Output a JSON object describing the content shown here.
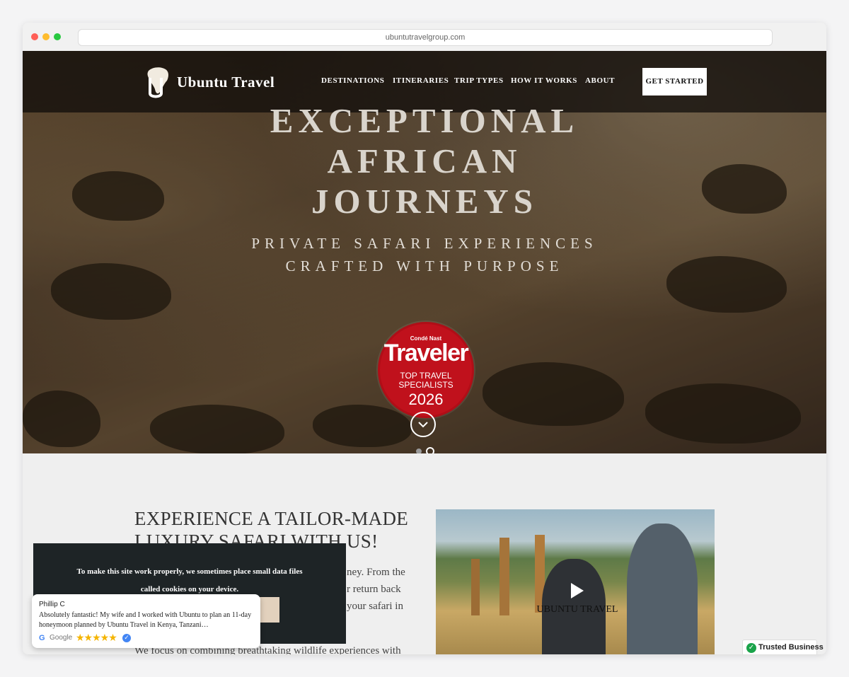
{
  "browser": {
    "url": "ubuntutravelgroup.com"
  },
  "nav": {
    "brand": "Ubuntu Travel",
    "items": [
      "DESTINATIONS",
      "ITINERARIES",
      "TRIP TYPES",
      "HOW IT WORKS",
      "ABOUT"
    ],
    "cta": "GET STARTED"
  },
  "hero": {
    "headline_lines": [
      "EXCEPTIONAL",
      "AFRICAN",
      "JOURNEYS"
    ],
    "subtitle_lines": [
      "PRIVATE SAFARI EXPERIENCES",
      "CRAFTED WITH PURPOSE"
    ],
    "badge": {
      "line1": "Condé Nast",
      "line2": "Traveler",
      "line3": "TOP TRAVEL",
      "line4": "SPECIALISTS",
      "year": "2026"
    },
    "slides": {
      "count": 2,
      "active": 2
    }
  },
  "intro": {
    "title_lines": [
      "EXPERIENCE A TAILOR-MADE",
      "LUXURY SAFARI WITH US!"
    ],
    "body_fragments": [
      "ney. From the",
      "r return back",
      "your safari in"
    ],
    "body_line_last": "We focus on combining breathtaking wildlife experiences with"
  },
  "video": {
    "overlay_brand": "UBUNTU TRAVEL"
  },
  "cookie": {
    "line1": "To make this site work properly, we sometimes place small data files",
    "line2": "called cookies on your device."
  },
  "review": {
    "name": "Phillip C",
    "text": "Absolutely fantastic! My wife and I worked with Ubuntu to plan an 11-day honeymoon planned by Ubuntu Travel in Kenya, Tanzani…",
    "source": "Google",
    "stars": "★★★★★",
    "rating": 5
  },
  "trusted": {
    "label": "Trusted Business"
  },
  "colors": {
    "badge_red": "#c0111c",
    "cookie_bg": "#1e2426",
    "cookie_button": "#e2d1bd"
  }
}
